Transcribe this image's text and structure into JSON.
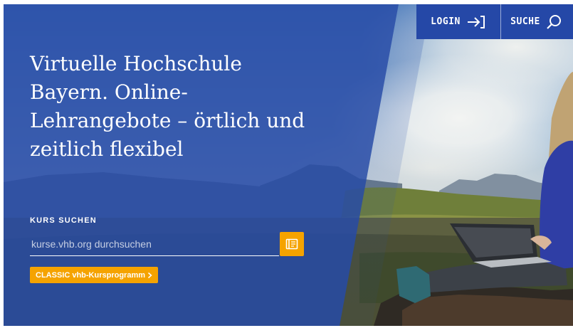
{
  "header": {
    "login_label": "LOGIN",
    "search_label": "SUCHE"
  },
  "hero": {
    "headline": "Virtuelle Hochschule Bayern. Online-Lehrangebote – örtlich und zeitlich flexibel"
  },
  "course_search": {
    "label": "KURS SUCHEN",
    "placeholder": "kurse.vhb.org durchsuchen",
    "value": "",
    "classic_button_label": "CLASSIC vhb-Kursprogramm"
  },
  "icons": {
    "login": "login-arrow-icon",
    "search": "magnifier-icon",
    "submit": "book-icon",
    "classic": "chevron-right-icon"
  },
  "colors": {
    "brand_blue": "#2548a7",
    "accent_orange": "#f5a300"
  }
}
